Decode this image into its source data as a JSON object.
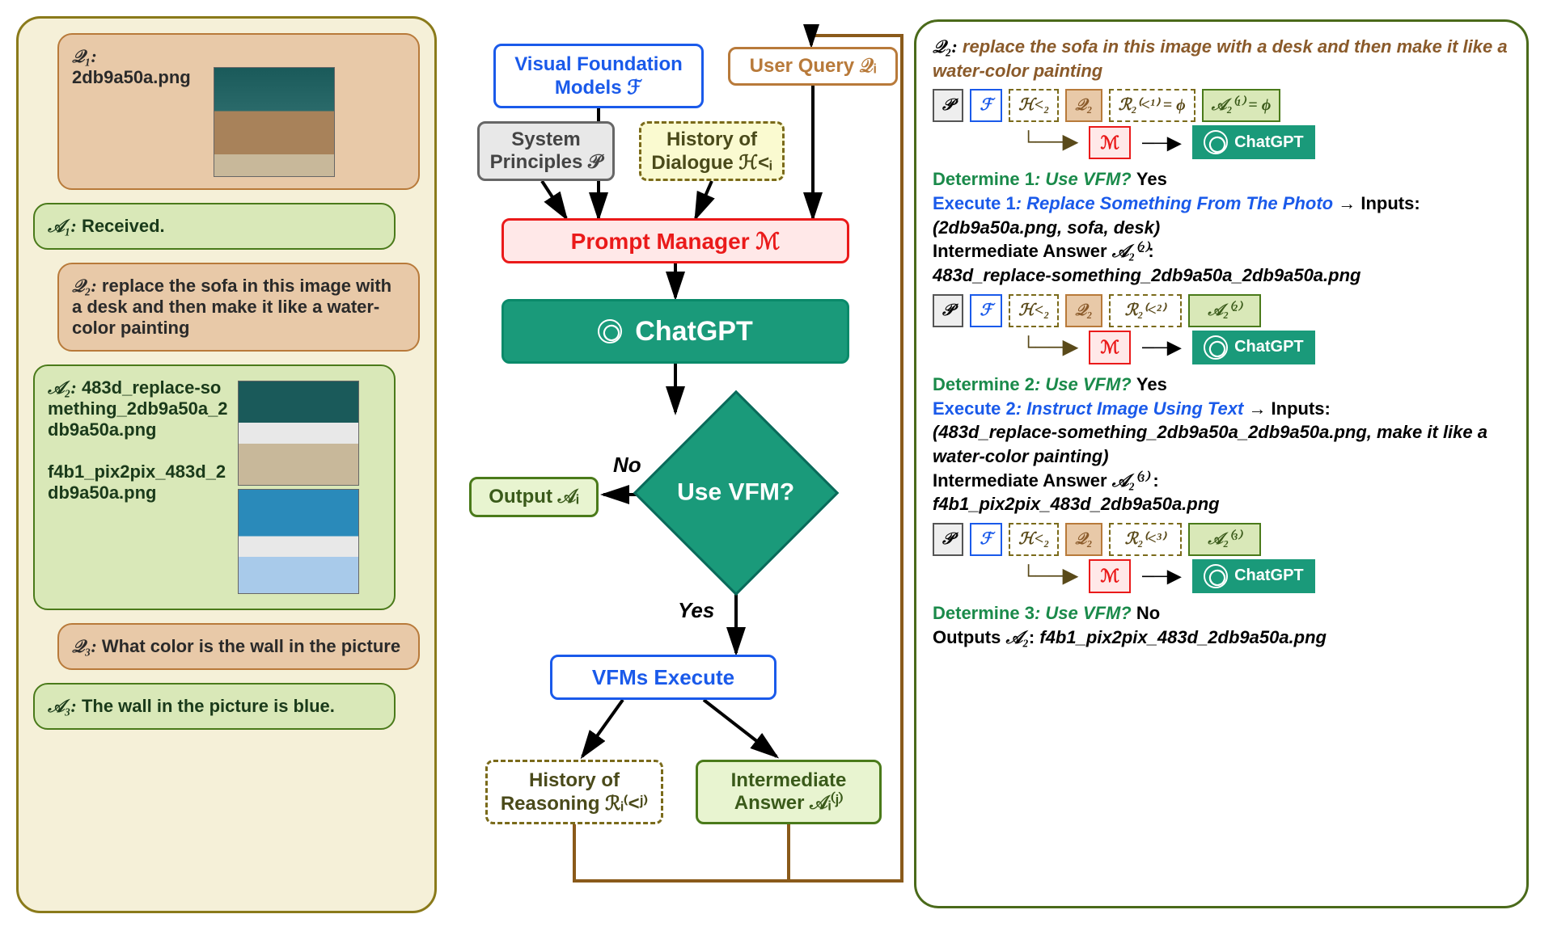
{
  "left": {
    "q1": {
      "label": "𝒬₁:",
      "filename": "2db9a50a.png"
    },
    "a1": {
      "label": "𝒜₁:",
      "text": "Received."
    },
    "q2": {
      "label": "𝒬₂:",
      "text": "replace the sofa in this image with a desk and then make it like a water-color painting"
    },
    "a2": {
      "label": "𝒜₂:",
      "file1": "483d_replace-something_2db9a50a_2db9a50a.png",
      "file2": "f4b1_pix2pix_483d_2db9a50a.png"
    },
    "q3": {
      "label": "𝒬₃:",
      "text": "What color is the wall in the picture"
    },
    "a3": {
      "label": "𝒜₃:",
      "text": "The wall in the picture is blue."
    }
  },
  "center": {
    "vfm": "Visual Foundation Models ℱ",
    "user_query": "User Query 𝒬ᵢ",
    "sys_principles": "System Principles 𝒫",
    "history_dialogue": "History of Dialogue ℋ<ᵢ",
    "prompt_manager": "Prompt  Manager ℳ",
    "chatgpt": "ChatGPT",
    "decision": "Use VFM?",
    "no_label": "No",
    "yes_label": "Yes",
    "output": "Output 𝒜ᵢ",
    "vfms_execute": "VFMs Execute",
    "history_reasoning": "History of Reasoning ℛᵢ⁽<ʲ⁾",
    "intermediate_answer": "Intermediate Answer 𝒜ᵢ⁽ʲ⁾"
  },
  "right": {
    "q2_label": "𝒬₂:",
    "q2_text": "replace the sofa in this image with a desk and then make it like a water-color painting",
    "tokens": {
      "P": "𝒫",
      "F": "ℱ",
      "H": "ℋ<₂",
      "Q": "𝒬₂",
      "M": "ℳ",
      "ChatGPT": "ChatGPT"
    },
    "row1": {
      "R": "ℛ₂⁽<¹⁾ = ϕ",
      "A": "𝒜₂⁽¹⁾ = ϕ"
    },
    "det1": {
      "label": "Determine 1",
      "q": ": Use VFM?",
      "ans": "Yes"
    },
    "exe1": {
      "label": "Execute 1",
      "action": ": Replace Something From The Photo",
      "arrow": "→ Inputs:",
      "inputs": "(2db9a50a.png, sofa, desk)"
    },
    "int1": {
      "label": "Intermediate Answer",
      "sym": "𝒜₂⁽²⁾",
      "colon": ":",
      "file": "483d_replace-something_2db9a50a_2db9a50a.png"
    },
    "row2": {
      "R": "ℛ₂⁽<²⁾",
      "A": "𝒜₂⁽²⁾"
    },
    "det2": {
      "label": "Determine 2",
      "q": ": Use VFM?",
      "ans": "Yes"
    },
    "exe2": {
      "label": "Execute 2",
      "action": ": Instruct Image Using Text",
      "arrow": "→ Inputs:",
      "inputs": "(483d_replace-something_2db9a50a_2db9a50a.png, make it like a water-color painting)"
    },
    "int2": {
      "label": "Intermediate Answer ",
      "sym": "𝒜₂⁽³⁾",
      "colon": " :",
      "file": "f4b1_pix2pix_483d_2db9a50a.png"
    },
    "row3": {
      "R": "ℛ₂⁽<³⁾",
      "A": "𝒜₂⁽³⁾"
    },
    "det3": {
      "label": "Determine 3",
      "q": ": Use VFM?",
      "ans": "No"
    },
    "out": {
      "label": "Outputs ",
      "sym": "𝒜₂",
      "colon": ": ",
      "file": "f4b1_pix2pix_483d_2db9a50a.png"
    }
  }
}
